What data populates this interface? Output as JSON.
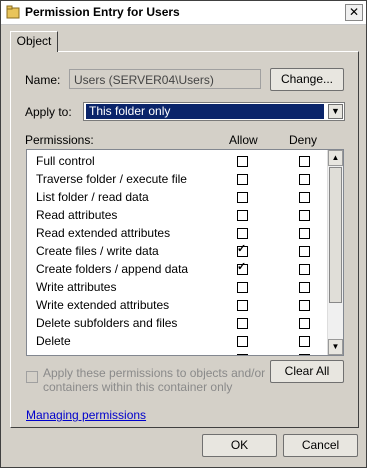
{
  "window": {
    "title": "Permission Entry for Users",
    "close_glyph": "✕"
  },
  "tabs": [
    {
      "label": "Object"
    }
  ],
  "name": {
    "label": "Name:",
    "value": "Users (SERVER04\\Users)",
    "change_button": "Change..."
  },
  "apply_to": {
    "label": "Apply to:",
    "value": "This folder only"
  },
  "permissions": {
    "header": "Permissions:",
    "allow_header": "Allow",
    "deny_header": "Deny",
    "items": [
      {
        "label": "Full control",
        "allow": false,
        "deny": false
      },
      {
        "label": "Traverse folder / execute file",
        "allow": false,
        "deny": false
      },
      {
        "label": "List folder / read data",
        "allow": false,
        "deny": false
      },
      {
        "label": "Read attributes",
        "allow": false,
        "deny": false
      },
      {
        "label": "Read extended attributes",
        "allow": false,
        "deny": false
      },
      {
        "label": "Create files / write data",
        "allow": true,
        "deny": false
      },
      {
        "label": "Create folders / append data",
        "allow": true,
        "deny": false
      },
      {
        "label": "Write attributes",
        "allow": false,
        "deny": false
      },
      {
        "label": "Write extended attributes",
        "allow": false,
        "deny": false
      },
      {
        "label": "Delete subfolders and files",
        "allow": false,
        "deny": false
      },
      {
        "label": "Delete",
        "allow": false,
        "deny": false
      },
      {
        "label": "",
        "allow": false,
        "deny": false
      }
    ]
  },
  "apply_checkbox": {
    "label": "Apply these permissions to objects and/or containers within this container only",
    "checked": false
  },
  "clear_all_button": "Clear All",
  "managing_link": "Managing permissions",
  "ok_button": "OK",
  "cancel_button": "Cancel",
  "icons": {
    "title": "folder-icon",
    "check": "✓"
  }
}
